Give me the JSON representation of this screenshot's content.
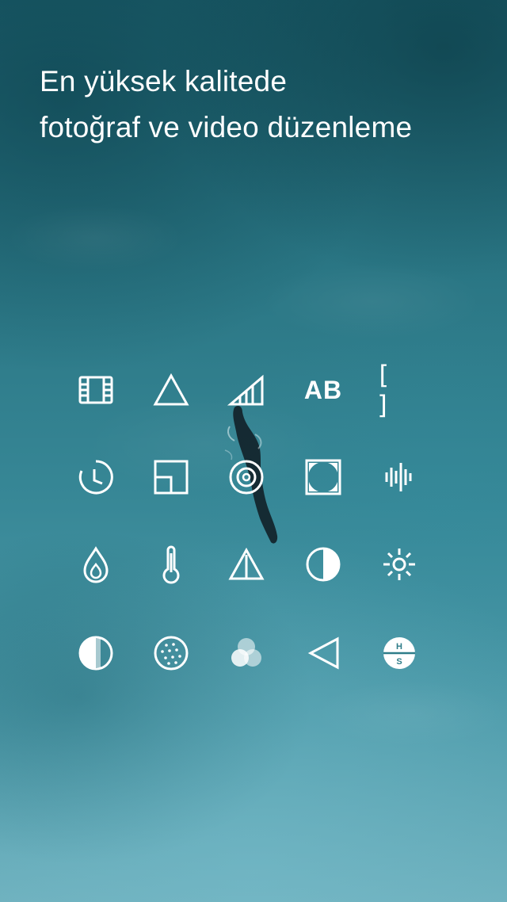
{
  "headline": {
    "line1": "En yüksek kalitede",
    "line2": "fotoğraf ve video düzenleme"
  },
  "tools": [
    {
      "icon": "film-strip-icon",
      "label": ""
    },
    {
      "icon": "triangle-icon",
      "label": ""
    },
    {
      "icon": "signal-bars-icon",
      "label": ""
    },
    {
      "icon": "text-ab-icon",
      "label": "AB"
    },
    {
      "icon": "crop-brackets-icon",
      "label": "[ ]"
    },
    {
      "icon": "speed-clock-icon",
      "label": ""
    },
    {
      "icon": "layout-frame-icon",
      "label": ""
    },
    {
      "icon": "target-circle-icon",
      "label": ""
    },
    {
      "icon": "vignette-square-icon",
      "label": ""
    },
    {
      "icon": "audio-waveform-icon",
      "label": ""
    },
    {
      "icon": "drop-icon",
      "label": ""
    },
    {
      "icon": "thermometer-icon",
      "label": ""
    },
    {
      "icon": "tint-triangle-icon",
      "label": ""
    },
    {
      "icon": "contrast-half-circle-icon",
      "label": ""
    },
    {
      "icon": "brightness-sun-icon",
      "label": ""
    },
    {
      "icon": "fade-circle-icon",
      "label": ""
    },
    {
      "icon": "grain-dots-icon",
      "label": ""
    },
    {
      "icon": "color-mix-icon",
      "label": ""
    },
    {
      "icon": "play-back-triangle-icon",
      "label": ""
    },
    {
      "icon": "highlights-shadows-icon",
      "label": ""
    }
  ],
  "hs_icon_letters": {
    "top": "H",
    "bottom": "S"
  },
  "colors": {
    "icon": "#ffffff",
    "background_dark": "#1b5e6b",
    "background_light": "#6eb0bd"
  }
}
